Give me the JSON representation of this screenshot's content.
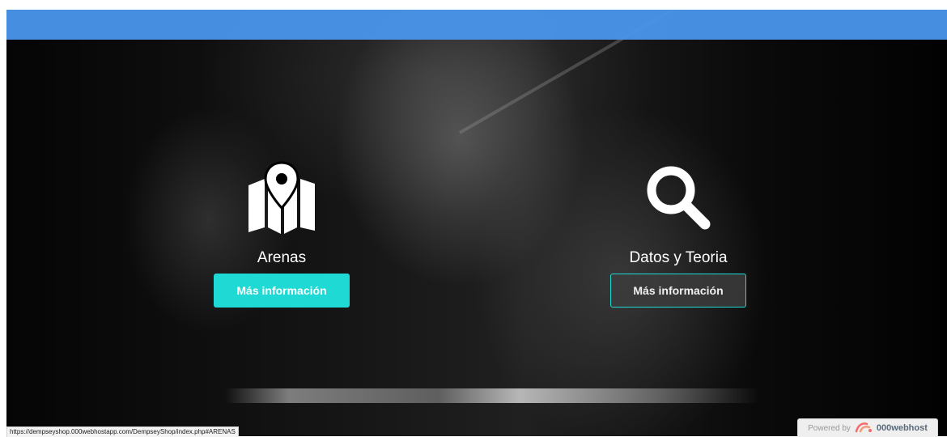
{
  "features": [
    {
      "title": "Arenas",
      "button_label": "Más información",
      "icon": "map-marker-icon"
    },
    {
      "title": "Datos y Teoria",
      "button_label": "Más información",
      "icon": "search-icon"
    }
  ],
  "status_bar": {
    "url": "https://dempseyshop.000webhostapp.com/DempseyShop/index.php#ARENAS"
  },
  "hosting_badge": {
    "prefix": "Powered by",
    "brand": "000webhost"
  },
  "colors": {
    "nav": "#4A96EB",
    "accent": "#1ED9D4",
    "background": "#000000"
  }
}
